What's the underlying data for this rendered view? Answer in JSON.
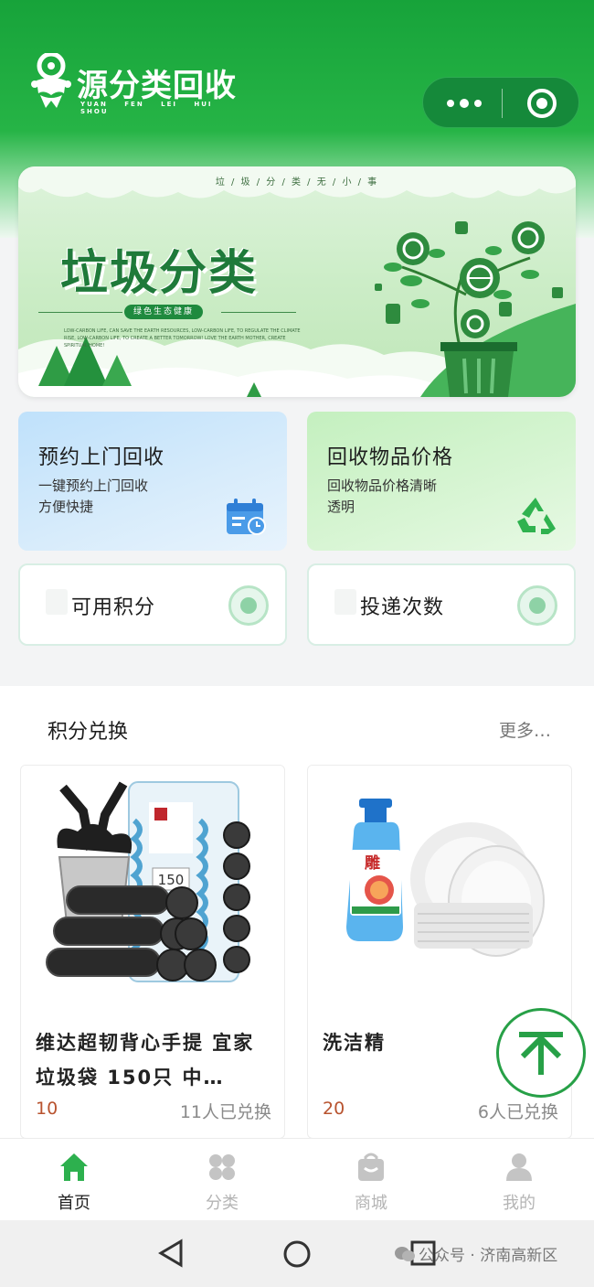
{
  "header": {
    "logo_text": "源分类回收",
    "logo_pinyin": "YUAN FEN LEI HUI SHOU",
    "brand_color": "#1fa83f"
  },
  "banner": {
    "top_slogan": "垃 / 圾 / 分 / 类 / 无 / 小 / 事",
    "title": "垃圾分类",
    "pill": "绿色生态健康",
    "desc": "LOW-CARBON LIFE, CAN SAVE THE EARTH RESOURCES, LOW-CARBON LIFE, TO REGULATE THE CLIMATE RISE, LOW-CARBON LIFE, TO CREATE A BETTER TOMORROW! LOVE THE EARTH MOTHER, CREATE SPIRITUAL HOME!"
  },
  "services": {
    "booking": {
      "title": "预约上门回收",
      "desc_line1": "一键预约上门回收",
      "desc_line2": "方便快捷",
      "icon": "calendar-clock-icon"
    },
    "price": {
      "title": "回收物品价格",
      "desc_line1": "回收物品价格清晰",
      "desc_line2": "透明",
      "icon": "recycle-icon"
    },
    "points": {
      "label": "可用积分",
      "icon": "points-icon"
    },
    "deliveries": {
      "label": "投递次数",
      "icon": "delivery-icon"
    }
  },
  "exchange": {
    "title": "积分兑换",
    "more": "更多…",
    "products": [
      {
        "name": "维达超韧背心手提 宜家垃圾袋 150只 中…",
        "points": "10",
        "redeemed": "11人已兑换",
        "pack_count": "150"
      },
      {
        "name": "洗洁精",
        "points": "20",
        "redeemed": "6人已兑换"
      }
    ]
  },
  "tabbar": {
    "items": [
      {
        "label": "首页",
        "icon": "home-icon",
        "active": true
      },
      {
        "label": "分类",
        "icon": "category-icon",
        "active": false
      },
      {
        "label": "商城",
        "icon": "shop-bag-icon",
        "active": false
      },
      {
        "label": "我的",
        "icon": "profile-icon",
        "active": false
      }
    ]
  },
  "watermark": "公众号 · 济南高新区"
}
